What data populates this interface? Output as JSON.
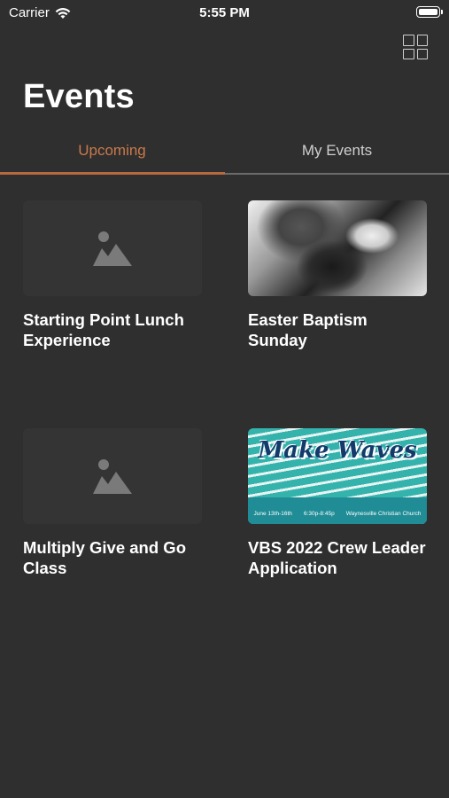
{
  "status_bar": {
    "carrier": "Carrier",
    "time": "5:55 PM",
    "battery_level": 1.0
  },
  "header": {
    "title": "Events",
    "grid_icon": "grid-view-icon"
  },
  "tabs": [
    {
      "label": "Upcoming",
      "active": true
    },
    {
      "label": "My Events",
      "active": false
    }
  ],
  "events": [
    {
      "title": "Starting Point Lunch Experience",
      "image": "placeholder-image-icon"
    },
    {
      "title": "Easter Baptism Sunday",
      "image": "baptism-photo"
    },
    {
      "title": "Multiply Give and Go Class",
      "image": "placeholder-image-icon"
    },
    {
      "title": "VBS 2022 Crew Leader Application",
      "image": "make-waves-graphic",
      "graphic_text": {
        "logo": "Make Waves",
        "date": "June 13th-16th",
        "time": "6:30p-8:45p",
        "location": "Waynesville Christian Church"
      }
    }
  ],
  "colors": {
    "background": "#2f2f2f",
    "accent": "#c9794a",
    "placeholder": "#343434",
    "inactive_tab": "#cfcfcf"
  }
}
